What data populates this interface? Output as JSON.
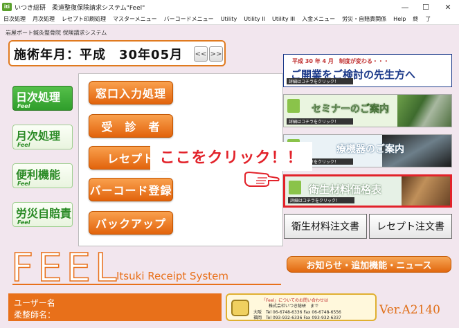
{
  "window": {
    "app_icon": "iti",
    "title": "いつき総研　柔道整復保険請求システム\"Feel\"",
    "minimize": "—",
    "maximize": "☐",
    "close": "✕"
  },
  "menubar": {
    "items": [
      "日次処理",
      "月次処理",
      "レセプト印刷処理",
      "マスターメニュー",
      "バーコードメニュー",
      "Utility",
      "Utility II",
      "Utility III",
      "入金メニュー",
      "労災・自賠責関係",
      "Help",
      "終",
      "了"
    ]
  },
  "system_name": "岩屋ポート鍼灸整骨院 保険請求システム",
  "month": {
    "text": "施術年月：平成　30年05月",
    "prev": "<<",
    "next": ">>"
  },
  "side_nav": [
    {
      "label": "日次処理",
      "sub": "Feel"
    },
    {
      "label": "月次処理",
      "sub": "Feel"
    },
    {
      "label": "便利機能",
      "sub": "Feel"
    },
    {
      "label": "労災自賠責",
      "sub": "Feel"
    }
  ],
  "center_buttons": [
    "窓口入力処理",
    "受　診　者",
    "レセプト",
    "バーコード登録",
    "バックアップ"
  ],
  "ads": {
    "ad1": {
      "small": "平成 30 年 4 月　制度が変わる・・・",
      "big": "ご開業をご検討の先生方へ",
      "link": "詳細はコチラをクリック！"
    },
    "ad2": {
      "big": "セミナーのご案内",
      "link": "詳細はコチラをクリック！"
    },
    "ad3": {
      "big": "療機器のご案内",
      "link": "詳細はコチラをクリック！"
    },
    "ad4": {
      "big": "衛生材料価格表",
      "link": "詳細はコチラをクリック！"
    }
  },
  "order_buttons": [
    "衛生材料注文書",
    "レセプト注文書"
  ],
  "callout": "ここをクリック！！",
  "logo": {
    "main": "FEEL",
    "sub": "Itsuki Receipt System"
  },
  "news_button": "お知らせ・追加機能・ニュース",
  "user": {
    "user_label": "ユーザー名",
    "practitioner_label": "柔整師名："
  },
  "contact": {
    "line1": "「Feel」についてのお問い合わせは",
    "line2": "株式会社いつき総研　まで",
    "line3": "大阪　Tel 06-6748-6336 Fax 06-6748-6556",
    "line4": "福岡　Tel 093-932-6336 Fax 093-932-6337"
  },
  "version": "Ver.A2140",
  "colors": {
    "accent": "#e8701a",
    "green": "#2f9e2b",
    "highlight": "#e2222a",
    "ad_title": "#1c3a8a"
  }
}
